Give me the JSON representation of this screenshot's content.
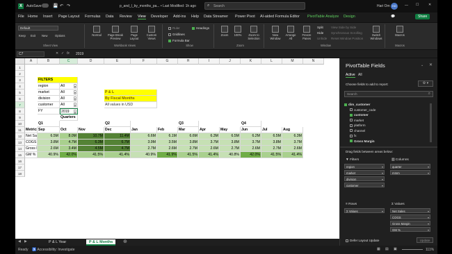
{
  "window": {
    "title": "p_and_l_by_months_pa... • Last Modified: 1h ago",
    "autosave": "AutoSave",
    "search_placeholder": "Search",
    "user": "Hari Om",
    "user_initials": "HO",
    "share": "Share"
  },
  "menu": [
    "File",
    "Home",
    "Insert",
    "Page Layout",
    "Formulas",
    "Data",
    "Review",
    "View",
    "Developer",
    "Add-ins",
    "Help",
    "Data Streamer",
    "Power Pivot",
    "AI-aided Formula Editor",
    "PivotTable Analyze",
    "Design"
  ],
  "ribbon": {
    "sheet_view": {
      "dropdown": "Default",
      "keep": "Keep",
      "exit": "Exit",
      "new": "New",
      "options": "Options",
      "label": "Sheet View"
    },
    "workbook_views": {
      "normal": "Normal",
      "page_break": "Page Break Preview",
      "page_layout": "Page Layout",
      "custom": "Custom Views",
      "label": "Workbook Views"
    },
    "show": {
      "ruler": "Ruler",
      "gridlines": "Gridlines",
      "formula_bar": "Formula Bar",
      "headings": "Headings",
      "label": "Show"
    },
    "zoom": {
      "zoom": "Zoom",
      "hundred": "100%",
      "to_selection": "Zoom to Selection",
      "label": "Zoom"
    },
    "window": {
      "new_window": "New Window",
      "arrange": "Arrange All",
      "freeze": "Freeze Panes",
      "split": "Split",
      "hide": "Hide",
      "unhide": "Unhide",
      "side_by_side": "View Side by Side",
      "sync_scroll": "Synchronous Scrolling",
      "reset": "Reset Window Position",
      "switch": "Switch Windows",
      "label": "Window"
    },
    "macros": {
      "macros": "Macros",
      "label": "Macros"
    }
  },
  "formula": {
    "namebox": "C7",
    "fx": "fx",
    "value": "2019"
  },
  "grid": {
    "columns": [
      "A",
      "B",
      "C",
      "D",
      "E",
      "F",
      "G",
      "H",
      "I",
      "J",
      "K",
      "L",
      "M",
      "N"
    ],
    "rows": [
      "1",
      "2",
      "3",
      "4",
      "5",
      "6",
      "7",
      "8",
      "9",
      "10",
      "11",
      "12",
      "13",
      "14",
      "15",
      "16",
      "17",
      "18"
    ],
    "filters_title": "FILTERS",
    "filters": [
      {
        "label": "region",
        "value": "All"
      },
      {
        "label": "market",
        "value": "All"
      },
      {
        "label": "division",
        "value": "All"
      },
      {
        "label": "customer",
        "value": "All"
      },
      {
        "label": "FY",
        "value": "2019"
      }
    ],
    "pl_box": [
      "P & L",
      "By Fiscal Months",
      "All values in USD"
    ],
    "quarters_label": "Quarters",
    "quarter_labels": [
      "Q1",
      "Q2",
      "Q3",
      "Q4"
    ],
    "metrics_header": "Metrics",
    "months": [
      "Sep",
      "Oct",
      "Nov",
      "Dec",
      "Jan",
      "Feb",
      "Mar",
      "Apr",
      "May",
      "Jun",
      "Jul",
      "Aug"
    ],
    "data": [
      {
        "metric": "Net Sales",
        "values": [
          "6.5M",
          "8.0M",
          "10.7M",
          "11.4M",
          "6.6M",
          "6.1M",
          "6.6M",
          "6.3M",
          "6.5M",
          "6.2M",
          "6.5M",
          "6.3M"
        ]
      },
      {
        "metric": "COGS",
        "values": [
          "3.8M",
          "4.7M",
          "6.3M",
          "6.7M",
          "3.9M",
          "3.5M",
          "3.8M",
          "3.7M",
          "3.8M",
          "3.7M",
          "3.8M",
          "3.7M"
        ]
      },
      {
        "metric": "Gross Margin",
        "values": [
          "2.6M",
          "3.4M",
          "4.5M",
          "4.7M",
          "2.7M",
          "2.6M",
          "2.7M",
          "2.6M",
          "2.7M",
          "2.6M",
          "2.7M",
          "2.6M"
        ]
      },
      {
        "metric": "GM %",
        "values": [
          "40.9%",
          "42.0%",
          "41.5%",
          "41.4%",
          "40.9%",
          "41.9%",
          "41.5%",
          "41.4%",
          "40.8%",
          "42.0%",
          "41.5%",
          "41.4%"
        ]
      }
    ],
    "colors": {
      "yellow": "#ffff00",
      "light_green": "#c6e0b4",
      "mid_green": "#a9d08e",
      "dark_green": "#548235",
      "deep_green": "#70ad47"
    }
  },
  "pane": {
    "title": "PivotTable Fields",
    "tabs": [
      "Active",
      "All"
    ],
    "subtitle": "Choose fields to add to report:",
    "search_placeholder": "Search",
    "fields": [
      {
        "name": "dim_customer",
        "checked": true,
        "bold": true
      },
      {
        "name": "customer_code",
        "checked": false
      },
      {
        "name": "customer",
        "checked": true,
        "bold": true
      },
      {
        "name": "market",
        "checked": false
      },
      {
        "name": "platform",
        "checked": false
      },
      {
        "name": "channel",
        "checked": false
      },
      {
        "name": "fx",
        "checked": false
      },
      {
        "name": "Gross Margin",
        "checked": true,
        "bold": true
      }
    ],
    "drag_text": "Drag fields between areas below:",
    "areas": {
      "filters_title": "Filters",
      "filters": [
        "region",
        "market",
        "division",
        "customer"
      ],
      "columns_title": "Columns",
      "columns": [
        "quarter",
        "mmm"
      ],
      "rows_title": "Rows",
      "rows": [
        "Σ Values"
      ],
      "values_title": "Σ Values",
      "values": [
        "Net Sales",
        "COGS",
        "Gross Margin",
        "GM %"
      ]
    },
    "defer": "Defer Layout Update",
    "update": "Update"
  },
  "sheets": [
    "P & L Year",
    "P & L Months"
  ],
  "status": {
    "ready": "Ready",
    "accessibility": "Accessibility: Investigate",
    "zoom": "111%"
  }
}
